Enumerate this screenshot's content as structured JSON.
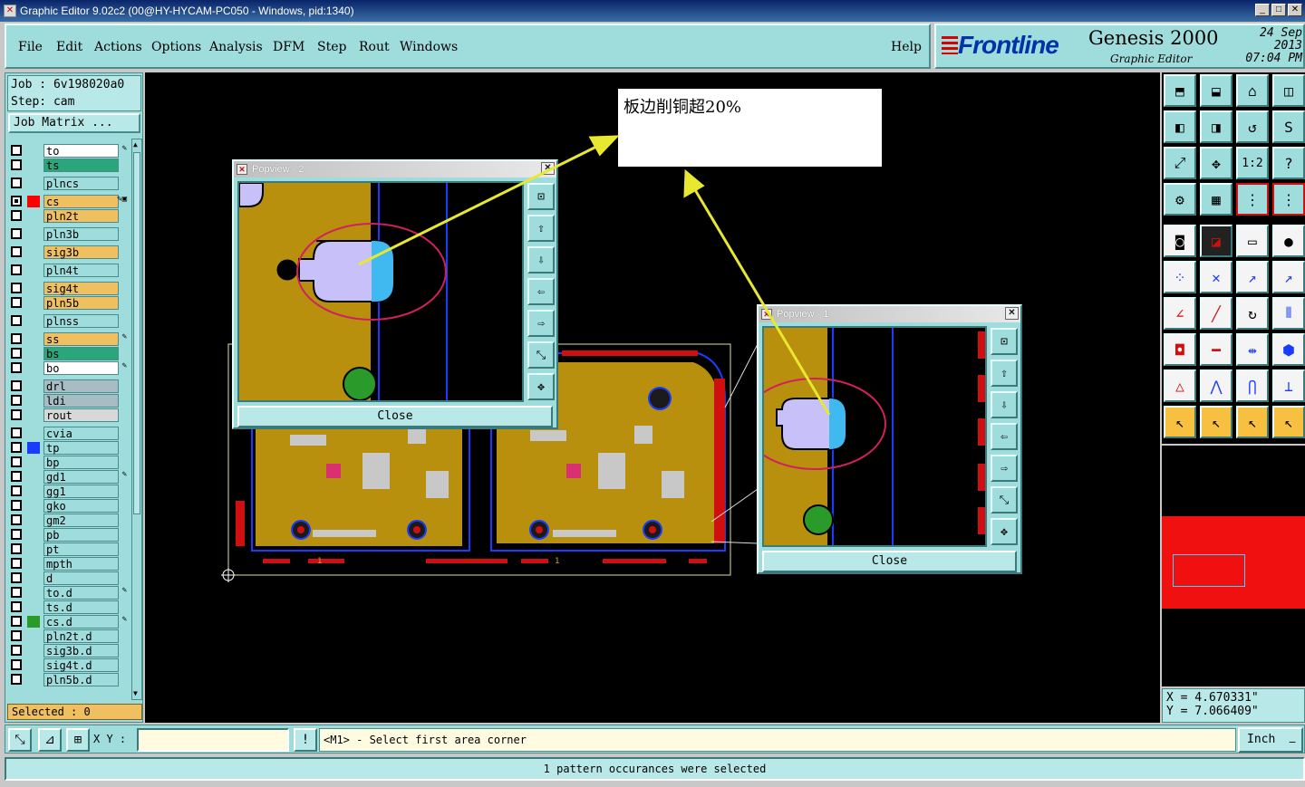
{
  "window": {
    "title": "Graphic Editor 9.02c2 (00@HY-HYCAM-PC050 - Windows, pid:1340)",
    "title_icon": "x-window-icon"
  },
  "menu": {
    "items": [
      "File",
      "Edit",
      "Actions",
      "Options",
      "Analysis",
      "DFM",
      "Step",
      "Rout",
      "Windows"
    ],
    "help": "Help"
  },
  "brand": {
    "logo": "Frontline",
    "product": "Genesis 2000",
    "subtitle": "Graphic Editor",
    "date": "24 Sep 2013",
    "time": "07:04 PM"
  },
  "job": {
    "job_line": "Job : 6v198020a0",
    "step_line": "Step: cam",
    "matrix_button": "Job Matrix ..."
  },
  "layers": [
    {
      "name": "to",
      "bg": "#ffffff",
      "swatch": "",
      "checked": false,
      "marker": "✎"
    },
    {
      "name": "ts",
      "bg": "#2aa67a",
      "swatch": "",
      "checked": false,
      "marker": ""
    },
    {
      "name": "plncs",
      "bg": "#9fdcdc",
      "swatch": "",
      "checked": false,
      "marker": ""
    },
    {
      "name": "cs",
      "bg": "#f0c060",
      "swatch": "#ff0000",
      "checked": true,
      "marker": "✎▣"
    },
    {
      "name": "pln2t",
      "bg": "#f0c060",
      "swatch": "",
      "checked": false,
      "marker": ""
    },
    {
      "name": "pln3b",
      "bg": "#9fdcdc",
      "swatch": "",
      "checked": false,
      "marker": ""
    },
    {
      "name": "sig3b",
      "bg": "#f0c060",
      "swatch": "",
      "checked": false,
      "marker": ""
    },
    {
      "name": "pln4t",
      "bg": "#9fdcdc",
      "swatch": "",
      "checked": false,
      "marker": ""
    },
    {
      "name": "sig4t",
      "bg": "#f0c060",
      "swatch": "",
      "checked": false,
      "marker": ""
    },
    {
      "name": "pln5b",
      "bg": "#f0c060",
      "swatch": "",
      "checked": false,
      "marker": ""
    },
    {
      "name": "plnss",
      "bg": "#9fdcdc",
      "swatch": "",
      "checked": false,
      "marker": ""
    },
    {
      "name": "ss",
      "bg": "#f0c060",
      "swatch": "",
      "checked": false,
      "marker": "✎"
    },
    {
      "name": "bs",
      "bg": "#2aa67a",
      "swatch": "",
      "checked": false,
      "marker": ""
    },
    {
      "name": "bo",
      "bg": "#ffffff",
      "swatch": "",
      "checked": false,
      "marker": "✎"
    },
    {
      "name": "drl",
      "bg": "#a8bcc4",
      "swatch": "",
      "checked": false,
      "marker": ""
    },
    {
      "name": "ldi",
      "bg": "#a8bcc4",
      "swatch": "",
      "checked": false,
      "marker": ""
    },
    {
      "name": "rout",
      "bg": "#d8d8d8",
      "swatch": "",
      "checked": false,
      "marker": ""
    },
    {
      "name": "cvia",
      "bg": "#9fdcdc",
      "swatch": "",
      "checked": false,
      "marker": ""
    },
    {
      "name": "tp",
      "bg": "#9fdcdc",
      "swatch": "#1a3cff",
      "checked": false,
      "marker": ""
    },
    {
      "name": "bp",
      "bg": "#9fdcdc",
      "swatch": "",
      "checked": false,
      "marker": ""
    },
    {
      "name": "gd1",
      "bg": "#9fdcdc",
      "swatch": "",
      "checked": false,
      "marker": "✎"
    },
    {
      "name": "gg1",
      "bg": "#9fdcdc",
      "swatch": "",
      "checked": false,
      "marker": ""
    },
    {
      "name": "gko",
      "bg": "#9fdcdc",
      "swatch": "",
      "checked": false,
      "marker": ""
    },
    {
      "name": "gm2",
      "bg": "#9fdcdc",
      "swatch": "",
      "checked": false,
      "marker": ""
    },
    {
      "name": "pb",
      "bg": "#9fdcdc",
      "swatch": "",
      "checked": false,
      "marker": ""
    },
    {
      "name": "pt",
      "bg": "#9fdcdc",
      "swatch": "",
      "checked": false,
      "marker": ""
    },
    {
      "name": "mpth",
      "bg": "#9fdcdc",
      "swatch": "",
      "checked": false,
      "marker": ""
    },
    {
      "name": "d",
      "bg": "#9fdcdc",
      "swatch": "",
      "checked": false,
      "marker": ""
    },
    {
      "name": "to.d",
      "bg": "#9fdcdc",
      "swatch": "",
      "checked": false,
      "marker": "✎"
    },
    {
      "name": "ts.d",
      "bg": "#9fdcdc",
      "swatch": "",
      "checked": false,
      "marker": ""
    },
    {
      "name": "cs.d",
      "bg": "#9fdcdc",
      "swatch": "#2a9a2a",
      "checked": false,
      "marker": "✎"
    },
    {
      "name": "pln2t.d",
      "bg": "#9fdcdc",
      "swatch": "",
      "checked": false,
      "marker": ""
    },
    {
      "name": "sig3b.d",
      "bg": "#9fdcdc",
      "swatch": "",
      "checked": false,
      "marker": ""
    },
    {
      "name": "sig4t.d",
      "bg": "#9fdcdc",
      "swatch": "",
      "checked": false,
      "marker": ""
    },
    {
      "name": "pln5b.d",
      "bg": "#9fdcdc",
      "swatch": "",
      "checked": false,
      "marker": ""
    }
  ],
  "selected": "Selected : 0",
  "note": "板边削铜超20%",
  "popviews": {
    "p2": {
      "title": "Popview - 2",
      "close": "Close"
    },
    "p1": {
      "title": "Popview - 1",
      "close": "Close"
    }
  },
  "pcb_labels": {
    "step_1a": "1",
    "step_1b": "1"
  },
  "coords": {
    "x": "X = 4.670331\"",
    "y": "Y = 7.066409\""
  },
  "command": {
    "xy_label": "X Y :",
    "xy_value": "",
    "prompt": "<M1> - Select first area corner",
    "unit": "Inch"
  },
  "status": "1 pattern occurances were selected",
  "colors": {
    "panel": "#9fdcdc",
    "copper": "#b8900e",
    "pad": "#c8c0f8",
    "pad_edge": "#40b8f0",
    "arrow": "#e8e830",
    "ellipse": "#d02060"
  }
}
